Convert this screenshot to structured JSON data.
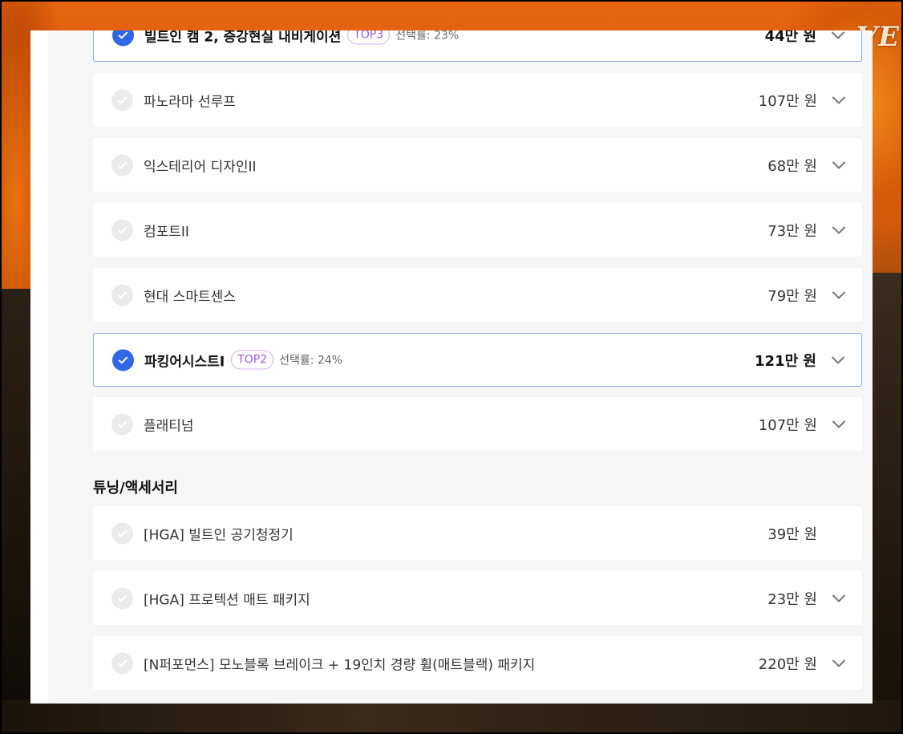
{
  "background": {
    "logo_text": "VE"
  },
  "colors": {
    "accent": "#2f67e6",
    "badge": "#9a57e0",
    "selected_border": "#8ea7e8"
  },
  "options": [
    {
      "label": "빌트인 캠 2, 증강현실 내비게이션",
      "badge": "TOP3",
      "rate": "선택률: 23%",
      "price": "44만 원",
      "selected": true
    },
    {
      "label": "파노라마 선루프",
      "price": "107만 원",
      "selected": false
    },
    {
      "label": "익스테리어 디자인II",
      "price": "68만 원",
      "selected": false
    },
    {
      "label": "컴포트II",
      "price": "73만 원",
      "selected": false
    },
    {
      "label": "현대 스마트센스",
      "price": "79만 원",
      "selected": false
    },
    {
      "label": "파킹어시스트I",
      "badge": "TOP2",
      "rate": "선택률: 24%",
      "price": "121만 원",
      "selected": true
    },
    {
      "label": "플래티넘",
      "price": "107만 원",
      "selected": false
    }
  ],
  "tuning_section": {
    "title": "튜닝/액세서리"
  },
  "accessories": [
    {
      "label": "[HGA] 빌트인 공기청정기",
      "price": "39만 원",
      "selected": false
    },
    {
      "label": "[HGA] 프로텍션 매트 패키지",
      "price": "23만 원",
      "selected": false
    },
    {
      "label": "[N퍼포먼스] 모노블록 브레이크 + 19인치 경량 휠(매트블랙) 패키지",
      "price": "220만 원",
      "selected": false
    }
  ]
}
